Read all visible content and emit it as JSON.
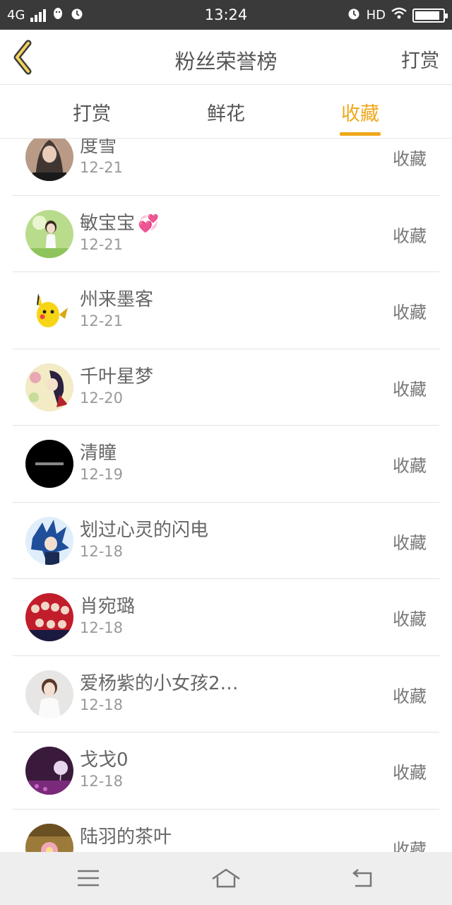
{
  "status_bar": {
    "network": "4G",
    "time": "13:24",
    "hd": "HD",
    "battery_level": 0.9
  },
  "nav": {
    "title": "粉丝荣誉榜",
    "right_action": "打赏"
  },
  "tabs": [
    {
      "label": "打赏",
      "active": false
    },
    {
      "label": "鲜花",
      "active": false
    },
    {
      "label": "收藏",
      "active": true
    }
  ],
  "rows": [
    {
      "name": "度雪",
      "date": "12-21",
      "action": "收藏"
    },
    {
      "name": "敏宝宝",
      "date": "12-21",
      "action": "收藏",
      "emoji": "💞"
    },
    {
      "name": "州来墨客",
      "date": "12-21",
      "action": "收藏"
    },
    {
      "name": "千叶星梦",
      "date": "12-20",
      "action": "收藏"
    },
    {
      "name": "清瞳",
      "date": "12-19",
      "action": "收藏"
    },
    {
      "name": "划过心灵的闪电",
      "date": "12-18",
      "action": "收藏"
    },
    {
      "name": "肖宛璐",
      "date": "12-18",
      "action": "收藏"
    },
    {
      "name": "爱杨紫的小女孩2…",
      "date": "12-18",
      "action": "收藏"
    },
    {
      "name": "戈戈0",
      "date": "12-18",
      "action": "收藏"
    },
    {
      "name": "陆羽的茶叶",
      "date": "",
      "action": "收藏"
    }
  ],
  "colors": {
    "accent": "#f0a81c",
    "status_bar_bg": "#3a3a3a",
    "text": "#666666"
  }
}
